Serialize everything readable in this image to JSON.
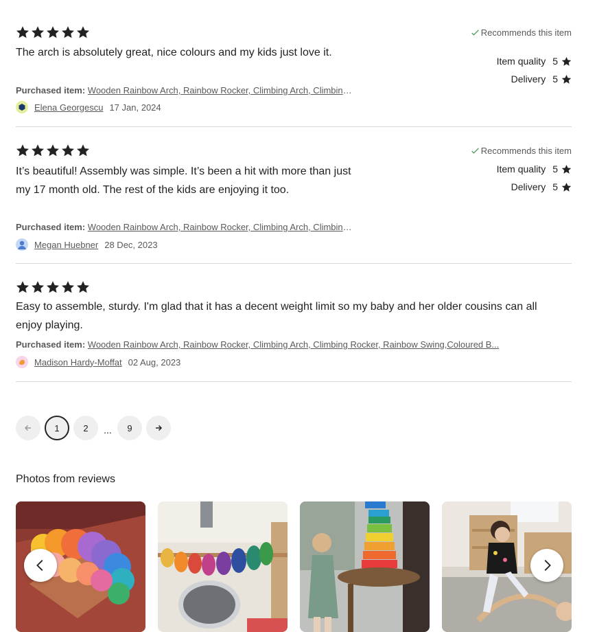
{
  "reviews": [
    {
      "rating": 5,
      "recommends": "Recommends this item",
      "text": "The arch is absolutely great, nice colours and my kids just love it.",
      "purchased_label": "Purchased item:",
      "purchased_item": "Wooden Rainbow Arch, Rainbow Rocker, Climbing Arch, Climbing Rocker, Rainbow Swing,Coloured B...",
      "author": "Elena Georgescu",
      "date": "17 Jan, 2024",
      "item_quality_label": "Item quality",
      "item_quality": "5",
      "delivery_label": "Delivery",
      "delivery": "5",
      "avatar_color": "#1a3a6e",
      "avatar_bg": "#e3ef9a"
    },
    {
      "rating": 5,
      "recommends": "Recommends this item",
      "text": "It’s beautiful! Assembly was simple. It’s been a hit with more than just my 17 month old. The rest of the kids are enjoying it too.",
      "purchased_label": "Purchased item:",
      "purchased_item": "Wooden Rainbow Arch, Rainbow Rocker, Climbing Arch, Climbing Rocker, Rainbow Swing,Coloured B...",
      "author": "Megan Huebner",
      "date": "28 Dec, 2023",
      "item_quality_label": "Item quality",
      "item_quality": "5",
      "delivery_label": "Delivery",
      "delivery": "5",
      "avatar_color": "#4a7bd0",
      "avatar_bg": "#c7d8f5"
    },
    {
      "rating": 5,
      "text": "Easy to assemble, sturdy. I'm glad that it has a decent weight limit so my baby and her older cousins can all enjoy playing.",
      "purchased_label": "Purchased item:",
      "purchased_item": "Wooden Rainbow Arch, Rainbow Rocker, Climbing Arch, Climbing Rocker, Rainbow Swing,Coloured B...",
      "author": "Madison Hardy-Moffat",
      "date": "02 Aug, 2023",
      "avatar_color": "#f29a3a",
      "avatar_bg": "#f7d6e8"
    }
  ],
  "pagination": {
    "pages": [
      "1",
      "2",
      "9"
    ],
    "ellipsis": "...",
    "current": "1"
  },
  "photos": {
    "title": "Photos from reviews",
    "items": [
      {
        "icon": "review-photo-rainbow-stacker"
      },
      {
        "icon": "review-photo-rainbow-stacker-mirror"
      },
      {
        "icon": "review-photo-child-rainbow-tower"
      },
      {
        "icon": "review-photo-child-rocker"
      }
    ]
  },
  "colors": {
    "text": "#222222",
    "muted": "#595959",
    "check": "#4a9a5a",
    "divider": "#d6d6d6"
  }
}
